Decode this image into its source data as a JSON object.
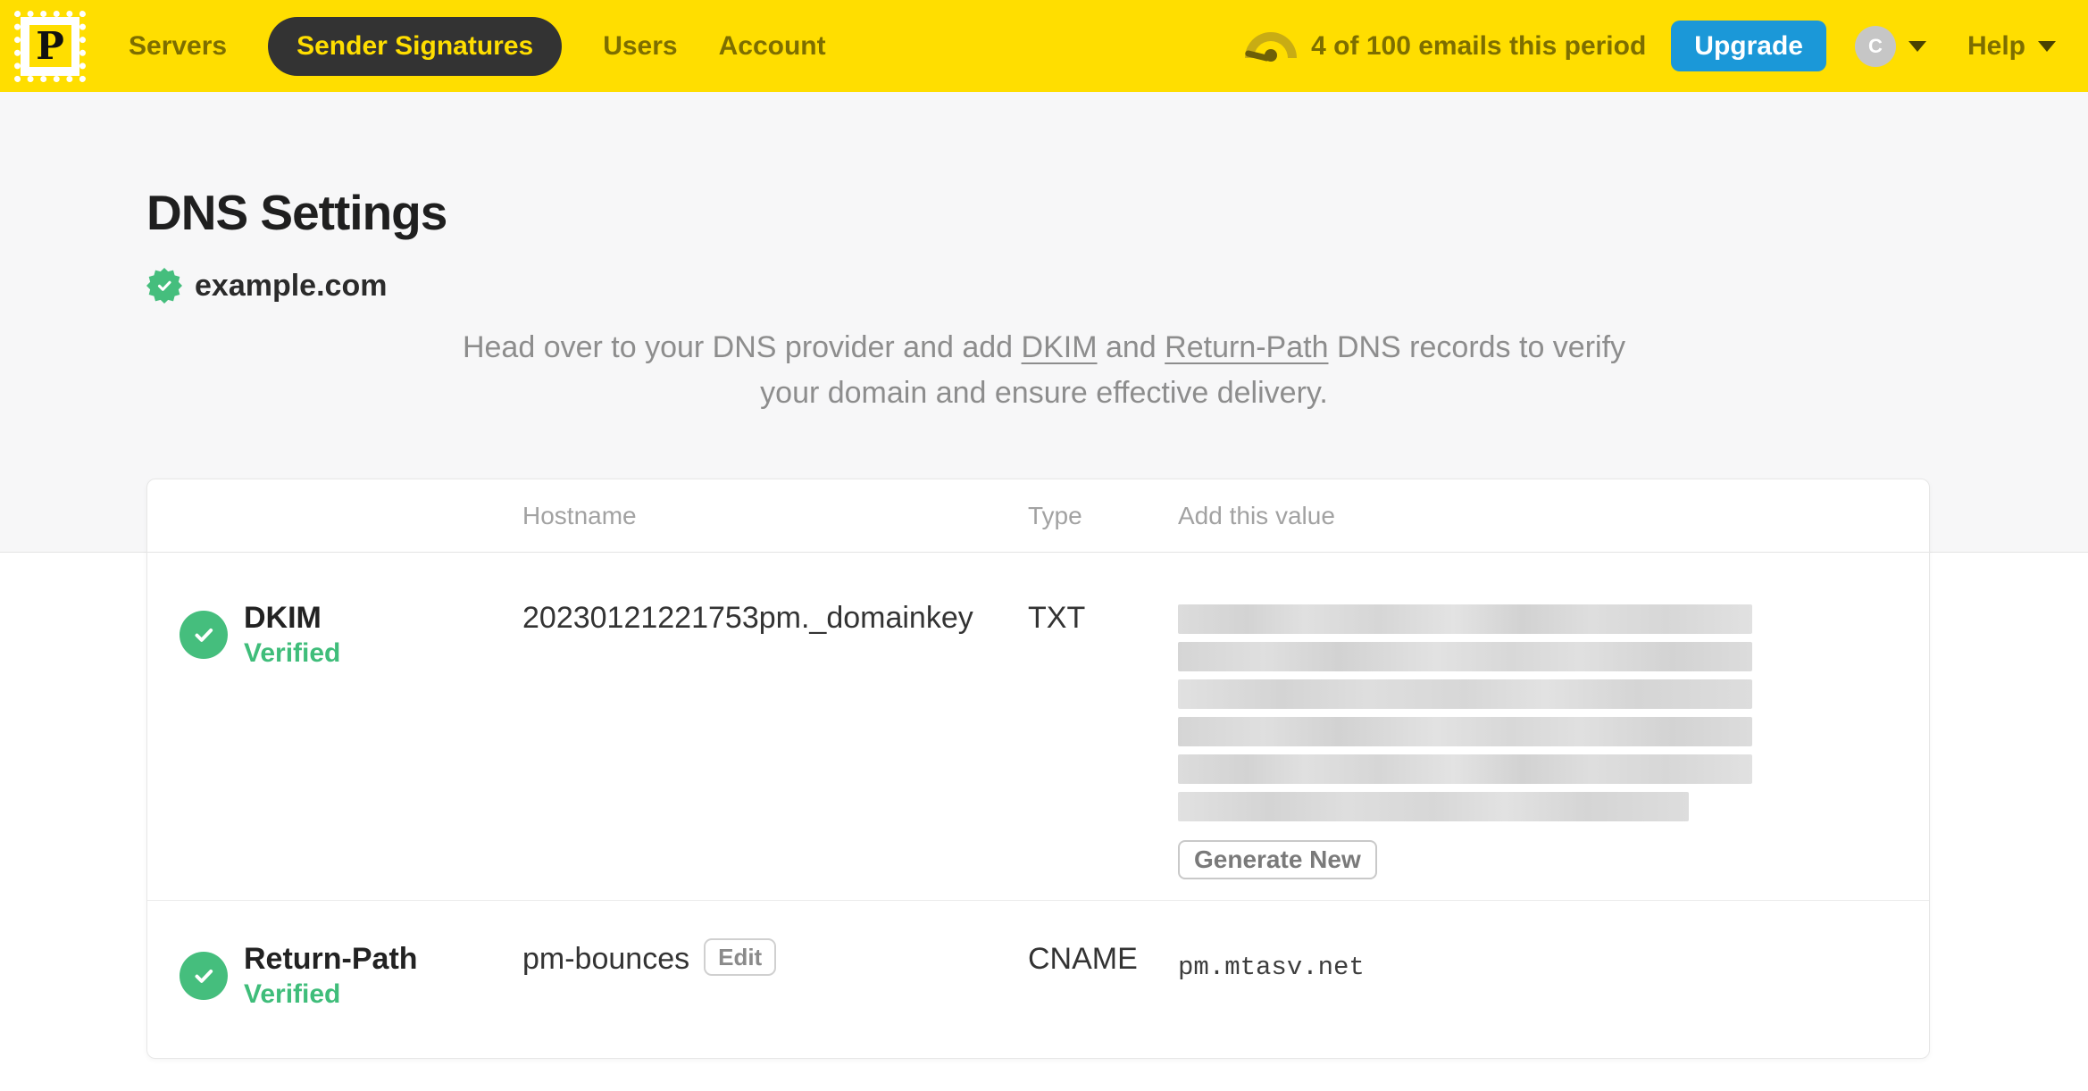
{
  "nav": {
    "logo_letter": "P",
    "items": [
      {
        "label": "Servers",
        "active": false
      },
      {
        "label": "Sender Signatures",
        "active": true
      },
      {
        "label": "Users",
        "active": false
      },
      {
        "label": "Account",
        "active": false
      }
    ],
    "usage_text": "4 of 100 emails this period",
    "upgrade_label": "Upgrade",
    "avatar_initial": "C",
    "help_label": "Help"
  },
  "page": {
    "title": "DNS Settings",
    "domain": "example.com",
    "domain_verified": true,
    "instructions": {
      "part1": "Head over to your DNS provider and add ",
      "link1": "DKIM",
      "part2": " and ",
      "link2": "Return-Path",
      "part3": " DNS records to verify your domain and ensure effective delivery."
    }
  },
  "table": {
    "headers": {
      "hostname": "Hostname",
      "type": "Type",
      "value": "Add this value"
    },
    "rows": [
      {
        "name": "DKIM",
        "status": "Verified",
        "hostname": "20230121221753pm._domainkey",
        "type": "TXT",
        "value_redacted": true,
        "action_label": "Generate New"
      },
      {
        "name": "Return-Path",
        "status": "Verified",
        "hostname": "pm-bounces",
        "edit_label": "Edit",
        "type": "CNAME",
        "value": "pm.mtasv.net"
      }
    ]
  },
  "colors": {
    "brand-yellow": "#FFDE00",
    "nav-ink": "#7d6e00",
    "pill-bg": "#333333",
    "upgrade-blue": "#1b98d8",
    "verified-green": "#45BE7D",
    "status-green-text": "#3fbd7a"
  }
}
